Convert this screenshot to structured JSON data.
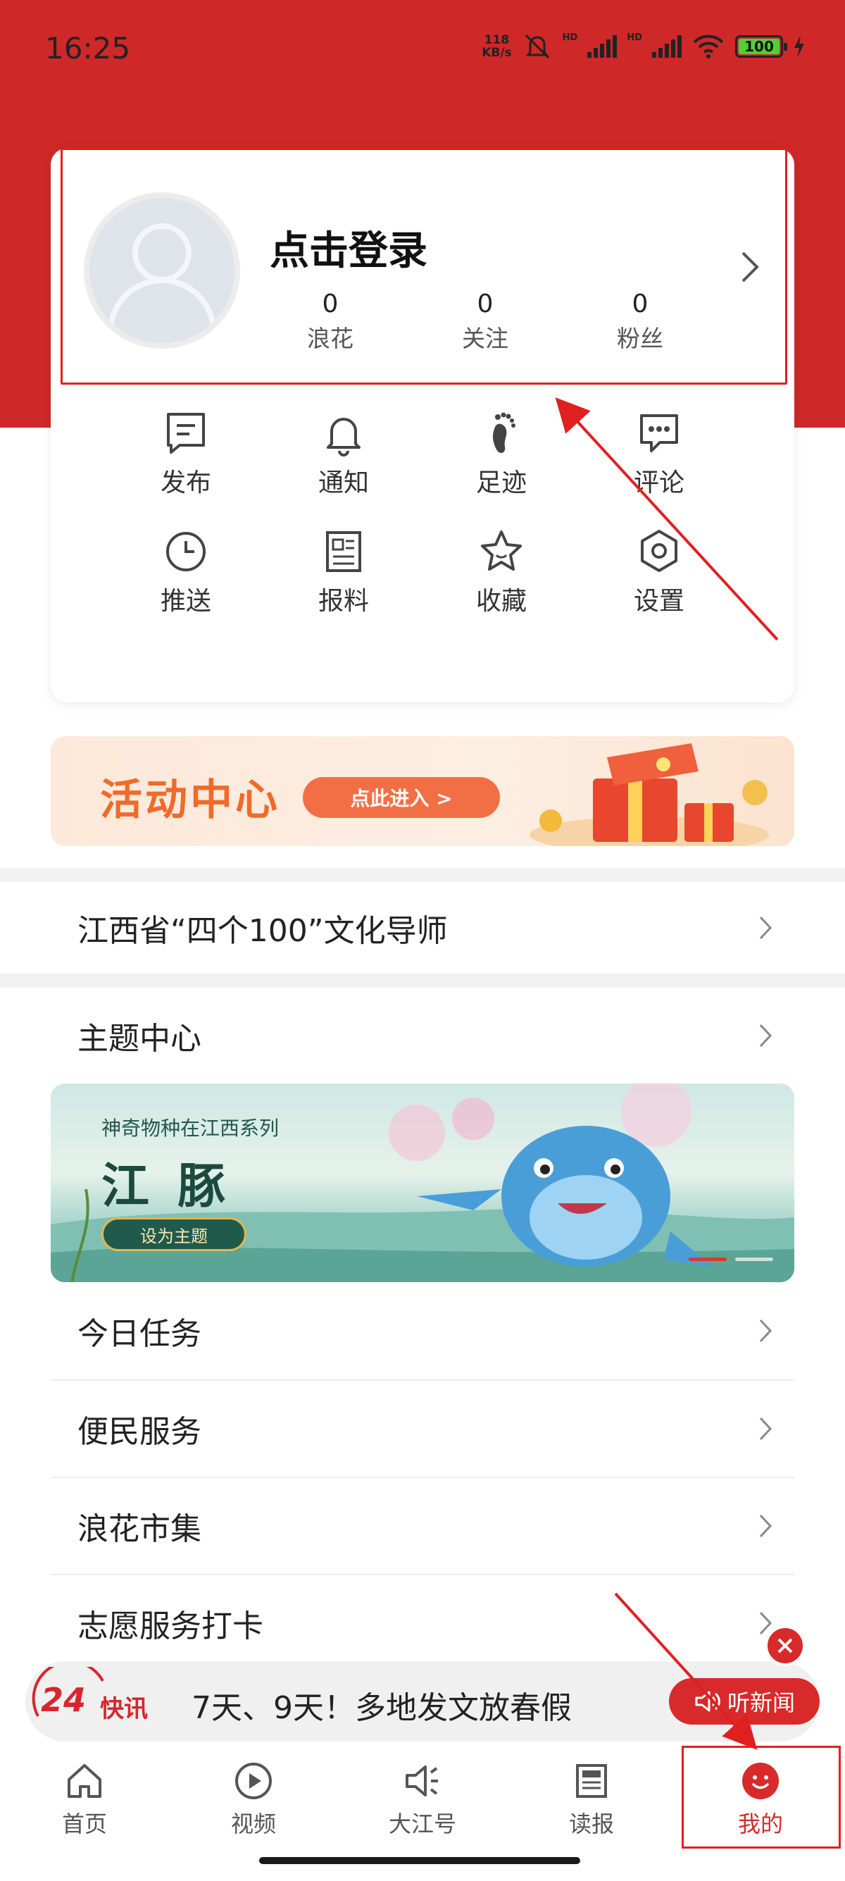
{
  "status_bar": {
    "time": "16:25",
    "net_speed_value": "118",
    "net_speed_unit": "KB/s",
    "hd_1": "HD",
    "hd_2": "HD",
    "battery": "100"
  },
  "profile": {
    "login_text": "点击登录",
    "stats": [
      {
        "value": "0",
        "label": "浪花"
      },
      {
        "value": "0",
        "label": "关注"
      },
      {
        "value": "0",
        "label": "粉丝"
      }
    ]
  },
  "quick_actions": [
    {
      "label": "发布",
      "icon": "publish-icon"
    },
    {
      "label": "通知",
      "icon": "bell-icon"
    },
    {
      "label": "足迹",
      "icon": "footprint-icon"
    },
    {
      "label": "评论",
      "icon": "comment-icon"
    },
    {
      "label": "推送",
      "icon": "clock-icon"
    },
    {
      "label": "报料",
      "icon": "report-icon"
    },
    {
      "label": "收藏",
      "icon": "star-icon"
    },
    {
      "label": "设置",
      "icon": "gear-icon"
    }
  ],
  "activity_banner": {
    "title": "活动中心",
    "button": "点此进入 >"
  },
  "menu": {
    "culture_mentor": "江西省“四个100”文化导师",
    "theme_center": "主题中心",
    "daily_tasks": "今日任务",
    "services": "便民服务",
    "market": "浪花市集",
    "volunteer": "志愿服务打卡"
  },
  "theme_banner": {
    "subtitle": "神奇物种在江西系列",
    "title": "江豚",
    "button": "设为主题"
  },
  "news_ticker": {
    "badge_number": "24",
    "badge_text": "快讯",
    "headline": "7天、9天！多地发文放春假",
    "listen_button": "听新闻"
  },
  "bottom_nav": [
    {
      "label": "首页",
      "icon": "home-icon",
      "active": false
    },
    {
      "label": "视频",
      "icon": "play-icon",
      "active": false
    },
    {
      "label": "大江号",
      "icon": "speaker-icon",
      "active": false
    },
    {
      "label": "读报",
      "icon": "newspaper-icon",
      "active": false
    },
    {
      "label": "我的",
      "icon": "smile-icon",
      "active": true
    }
  ],
  "colors": {
    "brand_red": "#cf2828",
    "accent_orange": "#f06a2a",
    "annotation_red": "#e02020"
  }
}
